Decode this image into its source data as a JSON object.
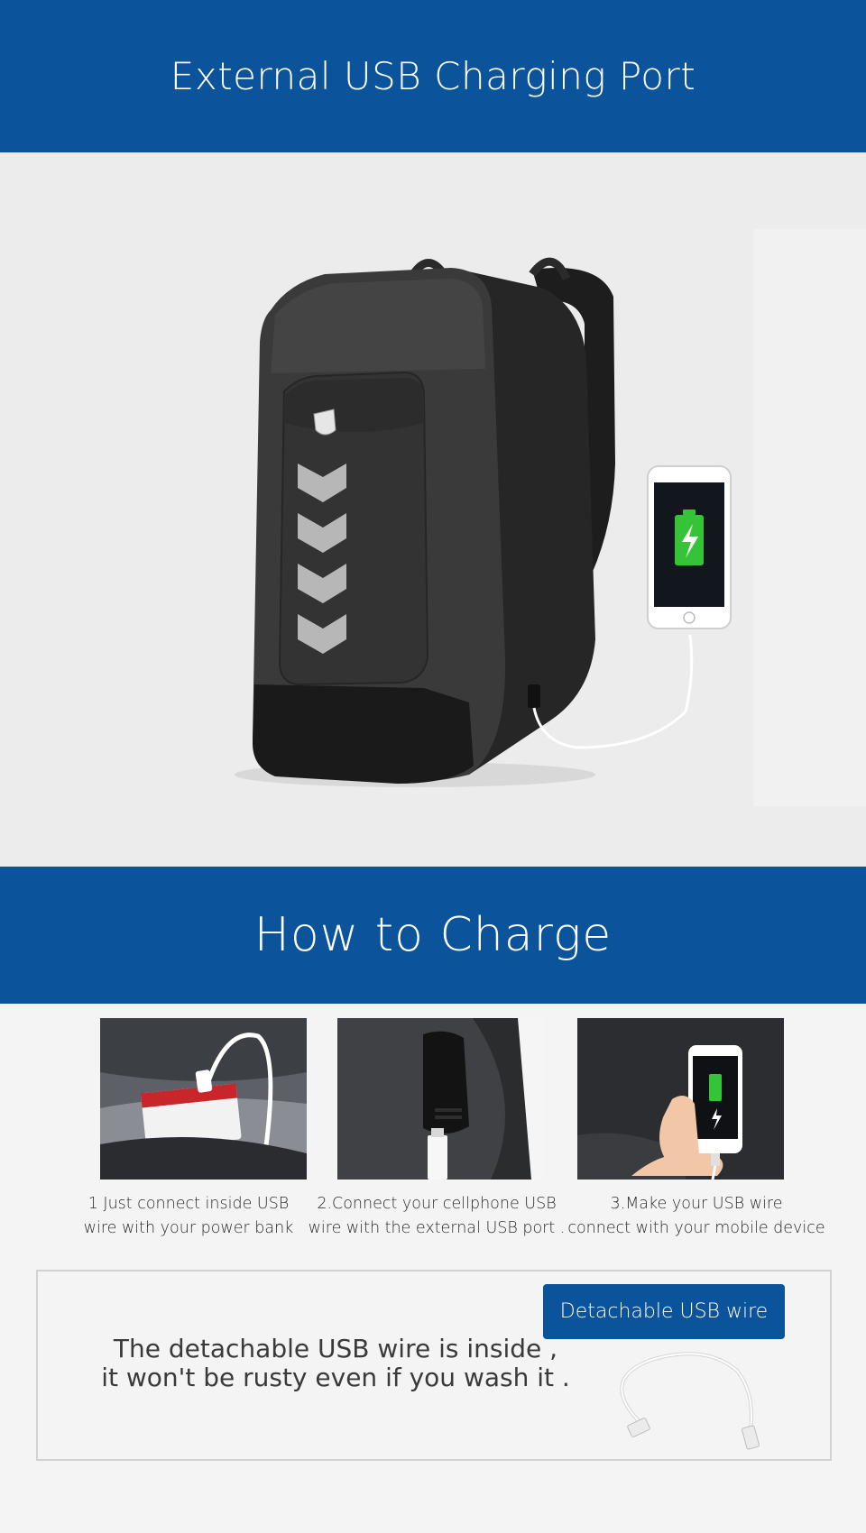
{
  "banner_top": {
    "title": "External USB Charging Port"
  },
  "banner_bottom": {
    "title": "How to Charge"
  },
  "hero": {
    "image": "backpack-with-phone-charging-image"
  },
  "steps": [
    {
      "image": "power-bank-in-pocket-image",
      "line1": "1 Just connect inside USB",
      "line2": "wire with your power bank"
    },
    {
      "image": "external-usb-port-image",
      "line1": "2.Connect your cellphone USB",
      "line2": "wire with the external  USB  port ."
    },
    {
      "image": "phone-charging-in-hand-image",
      "line1": "3.Make your USB wire",
      "line2": "connect with your mobile device"
    }
  ],
  "info": {
    "line1": "The detachable USB wire is inside ,",
    "line2": "it won't be rusty even if you wash it .",
    "badge": "Detachable USB wire"
  },
  "colors": {
    "accent": "#0b539b",
    "background": "#f4f4f4",
    "battery_green": "#35c437"
  }
}
